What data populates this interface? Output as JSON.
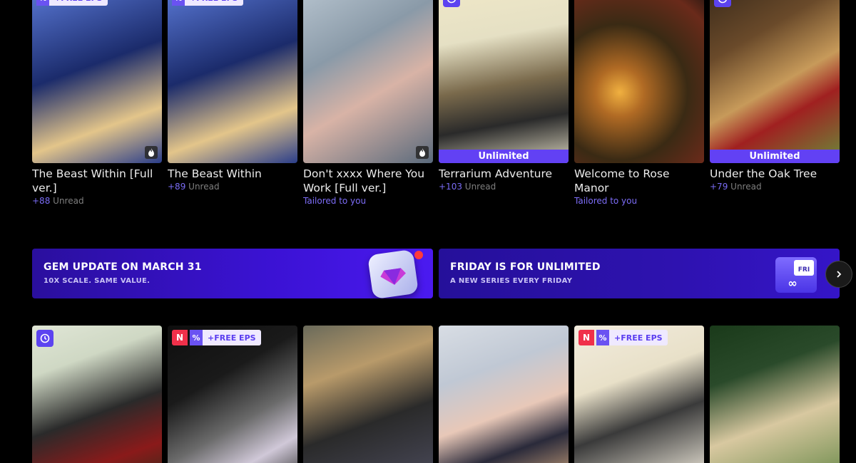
{
  "top_row": [
    {
      "title": "The Beast Within [Full ver.]",
      "count": "+88",
      "status": "Unread",
      "badge": "+FREE EPS",
      "colors": [
        "#1b2b6b",
        "#3a56b0",
        "#e3c58a"
      ]
    },
    {
      "title": "The Beast Within",
      "count": "+89",
      "status": "Unread",
      "badge": "+FREE EPS",
      "colors": [
        "#1b2b6b",
        "#3a56b0",
        "#e3c58a"
      ]
    },
    {
      "title": "Don't xxxx Where You Work [Full ver.]",
      "tagline": "Tailored to you",
      "colors": [
        "#8a9aa8",
        "#d8b3a6",
        "#5a6a7c"
      ]
    },
    {
      "title": "Terrarium Adventure",
      "count": "+103",
      "status": "Unread",
      "unlimited": "Unlimited",
      "colors": [
        "#e5e0c4",
        "#7a6a4c",
        "#2a2a2a"
      ]
    },
    {
      "title": "Welcome to Rose Manor",
      "tagline": "Tailored to you",
      "colors": [
        "#3a2a14",
        "#b06a24",
        "#6a2a1a"
      ]
    },
    {
      "title": "Under the Oak Tree",
      "count": "+79",
      "status": "Unread",
      "unlimited": "Unlimited",
      "colors": [
        "#6a4a2a",
        "#c79a5a",
        "#a02020"
      ]
    }
  ],
  "banners": [
    {
      "title": "GEM UPDATE ON MARCH 31",
      "subtitle": "10X SCALE. SAME VALUE."
    },
    {
      "title": "FRIDAY IS FOR UNLIMITED",
      "subtitle": "A NEW SERIES EVERY FRIDAY",
      "art_label": "FRI"
    }
  ],
  "bottom_row": [
    {
      "colors": [
        "#cfd8c4",
        "#2a2a2a",
        "#8a1a1a"
      ]
    },
    {
      "badge_n": "N",
      "badge_free": "+FREE EPS",
      "colors": [
        "#1a1a1a",
        "#6a6a6a",
        "#d0c8d8"
      ]
    },
    {
      "colors": [
        "#2a2a2a",
        "#b89a6a",
        "#4a4a5a"
      ]
    },
    {
      "colors": [
        "#c0c8d4",
        "#e8c8b8",
        "#2a2a3a"
      ]
    },
    {
      "badge_n": "N",
      "badge_free": "+FREE EPS",
      "colors": [
        "#e8e0c8",
        "#3a3a3a",
        "#f2ecde"
      ]
    },
    {
      "colors": [
        "#2a4a2a",
        "#d8c8a0",
        "#6a8a4a"
      ]
    }
  ]
}
